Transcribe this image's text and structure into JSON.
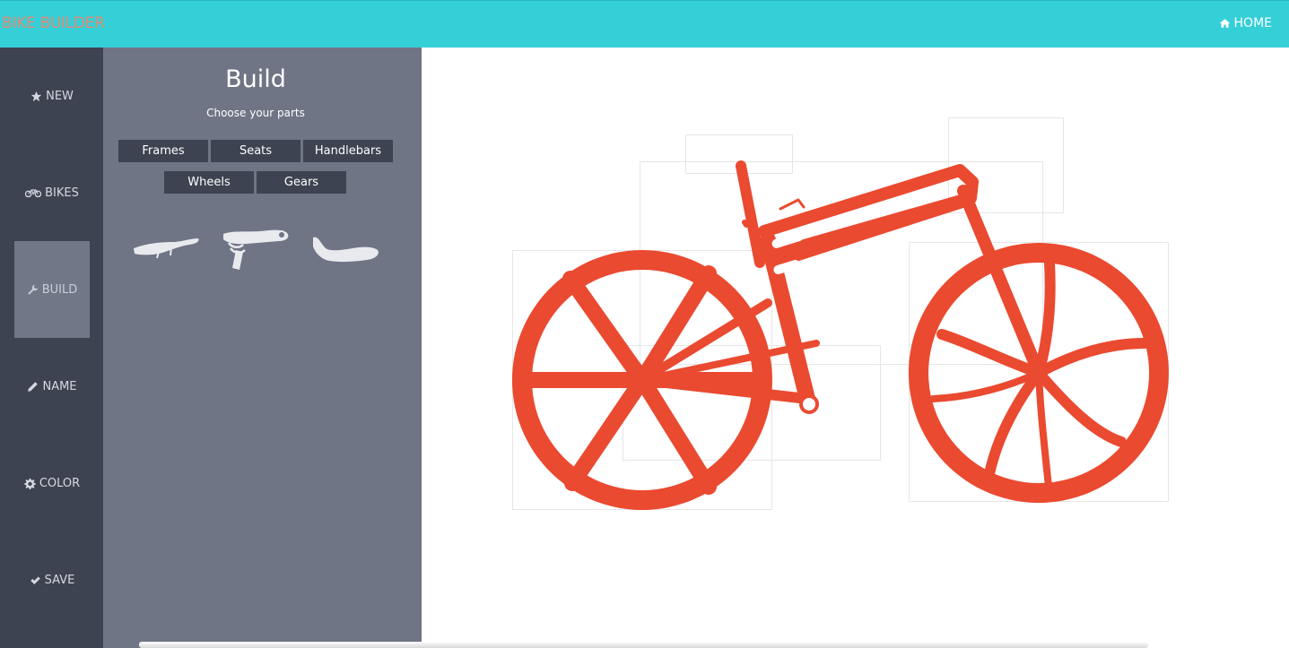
{
  "app": {
    "brand": "BIKE BUILDER",
    "home_label": "HOME",
    "home_icon": "home-icon"
  },
  "nav": {
    "items": [
      {
        "label": "NEW",
        "icon": "star-icon"
      },
      {
        "label": "BIKES",
        "icon": "bicycle-icon"
      },
      {
        "label": "BUILD",
        "icon": "wrench-icon",
        "active": true
      },
      {
        "label": "NAME",
        "icon": "pencil-icon"
      },
      {
        "label": "COLOR",
        "icon": "gear-icon"
      },
      {
        "label": "SAVE",
        "icon": "check-icon"
      }
    ]
  },
  "panel": {
    "title": "Build",
    "subtitle": "Choose your parts",
    "tabs": [
      "Frames",
      "Seats",
      "Handlebars",
      "Wheels",
      "Gears"
    ],
    "parts": [
      "seat-option-1",
      "seat-option-2",
      "seat-option-3"
    ]
  },
  "colors": {
    "topbar": "#35cfd8",
    "brand_text": "#e08a72",
    "nav_bg": "#3d4350",
    "panel_bg": "#6f7585",
    "bike": "#ea4a30"
  }
}
